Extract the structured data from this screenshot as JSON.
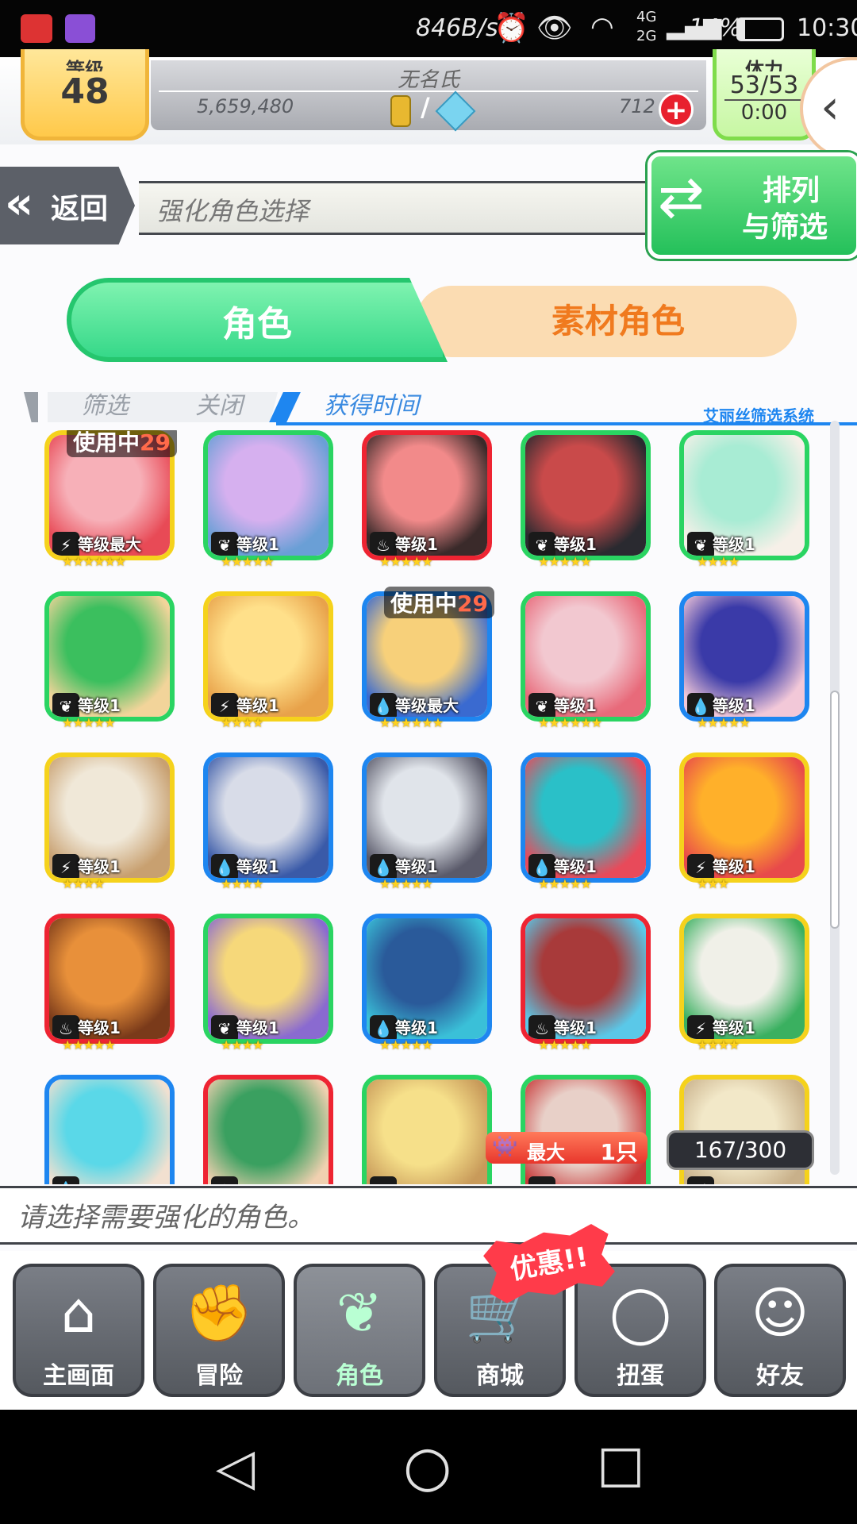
{
  "status_bar": {
    "speed": "846B/s",
    "network": "4G 2G",
    "battery": "14%",
    "time": "10:30"
  },
  "header": {
    "level_label": "等级",
    "level": "48",
    "player_name": "无名氏",
    "coins": "5,659,480",
    "currency_sep": "/",
    "gems": "712",
    "stamina_label": "体力",
    "stamina": "53/53",
    "stamina_timer": "0:00"
  },
  "subheader": {
    "back_label": "返回",
    "title": "强化角色选择",
    "sort_label_line1": "排列",
    "sort_label_line2": "与筛选"
  },
  "tabs": {
    "character": "角色",
    "material": "素材角色"
  },
  "filter": {
    "filter_label": "筛选",
    "filter_value": "关闭",
    "sort_label": "获得时间",
    "system_label": "艾丽丝筛选系统"
  },
  "cards": [
    {
      "frame": "yellow",
      "attr": "⚡",
      "level": "等级最大",
      "stars": "★★★★★★",
      "in_use": "使用中",
      "portrait_colors": [
        "#f7b0b8",
        "#e84a56"
      ]
    },
    {
      "frame": "green",
      "attr": "❦",
      "level": "等级1",
      "stars": "★★★★★",
      "in_use": "",
      "portrait_colors": [
        "#d6b0ef",
        "#6a9fd6"
      ]
    },
    {
      "frame": "red",
      "attr": "♨",
      "level": "等级1",
      "stars": "★★★★★",
      "in_use": "",
      "portrait_colors": [
        "#f28a8a",
        "#3a2a2a"
      ]
    },
    {
      "frame": "green",
      "attr": "❦",
      "level": "等级1",
      "stars": "★★★★★",
      "in_use": "",
      "portrait_colors": [
        "#c94a4a",
        "#2a2a30"
      ]
    },
    {
      "frame": "green",
      "attr": "❦",
      "level": "等级1",
      "stars": "★★★★",
      "in_use": "",
      "portrait_colors": [
        "#a8ecd4",
        "#f6f0e8"
      ]
    },
    {
      "frame": "green",
      "attr": "❦",
      "level": "等级1",
      "stars": "★★★★★",
      "in_use": "",
      "portrait_colors": [
        "#3bbf5e",
        "#f2d49a"
      ]
    },
    {
      "frame": "yellow",
      "attr": "⚡",
      "level": "等级1",
      "stars": "★★★★",
      "in_use": "",
      "portrait_colors": [
        "#ffe08a",
        "#e8a24a"
      ]
    },
    {
      "frame": "blue",
      "attr": "💧",
      "level": "等级最大",
      "stars": "★★★★★★",
      "in_use": "使用中",
      "portrait_colors": [
        "#f7d07a",
        "#3a6ad0"
      ]
    },
    {
      "frame": "green",
      "attr": "❦",
      "level": "等级1",
      "stars": "★★★★★★",
      "in_use": "",
      "portrait_colors": [
        "#f2c8d0",
        "#e86a7a"
      ]
    },
    {
      "frame": "blue",
      "attr": "💧",
      "level": "等级1",
      "stars": "★★★★★",
      "in_use": "",
      "portrait_colors": [
        "#3a3aa8",
        "#f2c8d8"
      ]
    },
    {
      "frame": "yellow",
      "attr": "⚡",
      "level": "等级1",
      "stars": "★★★★",
      "in_use": "",
      "portrait_colors": [
        "#f0e8d8",
        "#c8a070"
      ]
    },
    {
      "frame": "blue",
      "attr": "💧",
      "level": "等级1",
      "stars": "★★★★",
      "in_use": "",
      "portrait_colors": [
        "#d8dce8",
        "#3a5aa8"
      ]
    },
    {
      "frame": "blue",
      "attr": "💧",
      "level": "等级1",
      "stars": "★★★★★",
      "in_use": "",
      "portrait_colors": [
        "#e0e4ea",
        "#5a5a6a"
      ]
    },
    {
      "frame": "blue",
      "attr": "💧",
      "level": "等级1",
      "stars": "★★★★★",
      "in_use": "",
      "portrait_colors": [
        "#2ac0c8",
        "#e84a5a"
      ]
    },
    {
      "frame": "yellow",
      "attr": "⚡",
      "level": "等级1",
      "stars": "★★★",
      "in_use": "",
      "portrait_colors": [
        "#ffb02a",
        "#e84a4a"
      ]
    },
    {
      "frame": "red",
      "attr": "♨",
      "level": "等级1",
      "stars": "★★★★★",
      "in_use": "",
      "portrait_colors": [
        "#e8903a",
        "#7a3a1a"
      ]
    },
    {
      "frame": "green",
      "attr": "❦",
      "level": "等级1",
      "stars": "★★★★",
      "in_use": "",
      "portrait_colors": [
        "#f6d87a",
        "#8a6ad0"
      ]
    },
    {
      "frame": "blue",
      "attr": "💧",
      "level": "等级1",
      "stars": "★★★★★",
      "in_use": "",
      "portrait_colors": [
        "#2a5a9a",
        "#3ac0d8"
      ]
    },
    {
      "frame": "red",
      "attr": "♨",
      "level": "等级1",
      "stars": "★★★★★",
      "in_use": "",
      "portrait_colors": [
        "#a83a3a",
        "#5ac8e8"
      ]
    },
    {
      "frame": "yellow",
      "attr": "⚡",
      "level": "等级1",
      "stars": "★★★★",
      "in_use": "",
      "portrait_colors": [
        "#f0f0e8",
        "#3ab060"
      ]
    },
    {
      "frame": "blue",
      "attr": "💧",
      "level": "",
      "stars": "",
      "in_use": "",
      "portrait_colors": [
        "#5ad8e8",
        "#f2e0d0"
      ]
    },
    {
      "frame": "red",
      "attr": "♨",
      "level": "",
      "stars": "",
      "in_use": "",
      "portrait_colors": [
        "#3aa060",
        "#f0d0b0"
      ]
    },
    {
      "frame": "green",
      "attr": "❦",
      "level": "",
      "stars": "",
      "in_use": "",
      "portrait_colors": [
        "#f6e08a",
        "#c89a5a"
      ]
    },
    {
      "frame": "green",
      "attr": "❦",
      "level": "",
      "stars": "",
      "in_use": "",
      "portrait_colors": [
        "#e8d0c8",
        "#c83a3a"
      ]
    },
    {
      "frame": "yellow",
      "attr": "⚡",
      "level": "",
      "stars": "",
      "in_use": "",
      "portrait_colors": [
        "#f2e8c8",
        "#c8b08a"
      ]
    }
  ],
  "in_use_suffix": "29",
  "badges": {
    "max_label": "最大",
    "max_count": "1只",
    "box_count": "167/300"
  },
  "message": "请选择需要强化的角色。",
  "nav": {
    "home": "主画面",
    "quest": "冒险",
    "character": "角色",
    "shop": "商城",
    "gacha": "扭蛋",
    "friends": "好友",
    "promo": "优惠!!"
  }
}
